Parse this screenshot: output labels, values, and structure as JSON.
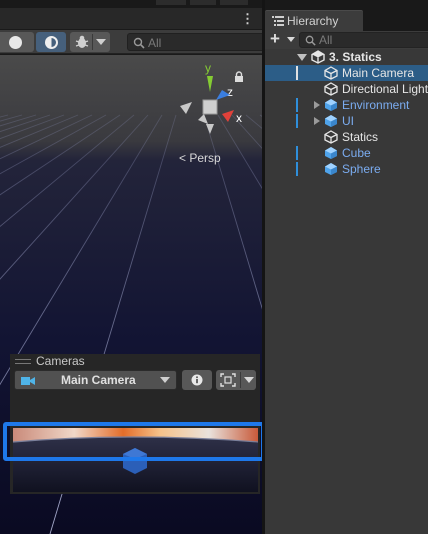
{
  "scene": {
    "gizmo": {
      "y_label": "y",
      "z_label": "z",
      "x_label": "x"
    },
    "persp_label": "< Persp",
    "search_placeholder": "All"
  },
  "cameras_overlay": {
    "title": "Cameras",
    "selected_camera": "Main Camera"
  },
  "hierarchy": {
    "tab_label": "Hierarchy",
    "search_placeholder": "All",
    "scene_name": "3. Statics",
    "items": [
      {
        "label": "Main Camera",
        "selected": true,
        "prefab": false,
        "has_children": false
      },
      {
        "label": "Directional Light",
        "selected": false,
        "prefab": false,
        "has_children": false
      },
      {
        "label": "Environment",
        "selected": false,
        "prefab": true,
        "has_children": true
      },
      {
        "label": "UI",
        "selected": false,
        "prefab": true,
        "has_children": true
      },
      {
        "label": "Statics",
        "selected": false,
        "prefab": false,
        "has_children": false
      },
      {
        "label": "Cube",
        "selected": false,
        "prefab": true,
        "has_children": false
      },
      {
        "label": "Sphere",
        "selected": false,
        "prefab": true,
        "has_children": false
      }
    ]
  },
  "colors": {
    "selection": "#2c5d87",
    "prefab_text": "#7bacf0",
    "highlight_border": "#1e78ea",
    "gizmo_y": "#85cc33",
    "gizmo_x": "#e0413a",
    "gizmo_z": "#3a7ee0"
  }
}
